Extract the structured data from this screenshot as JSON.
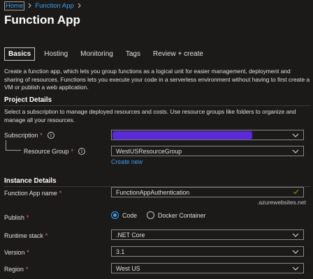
{
  "breadcrumb": {
    "home": "Home",
    "current": "Function App"
  },
  "page_title": "Function App",
  "tabs": [
    {
      "label": "Basics"
    },
    {
      "label": "Hosting"
    },
    {
      "label": "Monitoring"
    },
    {
      "label": "Tags"
    },
    {
      "label": "Review + create"
    }
  ],
  "description": "Create a function app, which lets you group functions as a logical unit for easier management, deployment and sharing of resources. Functions lets you execute your code in a serverless environment without having to first create a VM or publish a web application.",
  "project_details": {
    "title": "Project Details",
    "description": "Select a subscription to manage deployed resources and costs. Use resource groups like folders to organize and manage all your resources.",
    "subscription_label": "Subscription",
    "subscription_value": "",
    "resource_group_label": "Resource Group",
    "resource_group_value": "WestUSResourceGroup",
    "create_new": "Create new"
  },
  "instance_details": {
    "title": "Instance Details",
    "function_app_name_label": "Function App name",
    "function_app_name_value": "FunctionAppAuthentication",
    "domain_suffix": ".azurewebsites.net",
    "publish_label": "Publish",
    "publish_options": [
      "Code",
      "Docker Container"
    ],
    "publish_selected": "Code",
    "runtime_stack_label": "Runtime stack",
    "runtime_stack_value": ".NET Core",
    "version_label": "Version",
    "version_value": "3.1",
    "region_label": "Region",
    "region_value": "West US"
  },
  "required_marker": "*",
  "info_glyph": "i",
  "colors": {
    "background": "#1b1a19",
    "link": "#3aa0f3",
    "required": "#f1707b",
    "valid_check": "#57a300",
    "redaction": "#5b2bd9"
  },
  "icons": [
    "chevron-right-icon",
    "info-icon",
    "chevron-down-icon",
    "checkmark-icon"
  ]
}
